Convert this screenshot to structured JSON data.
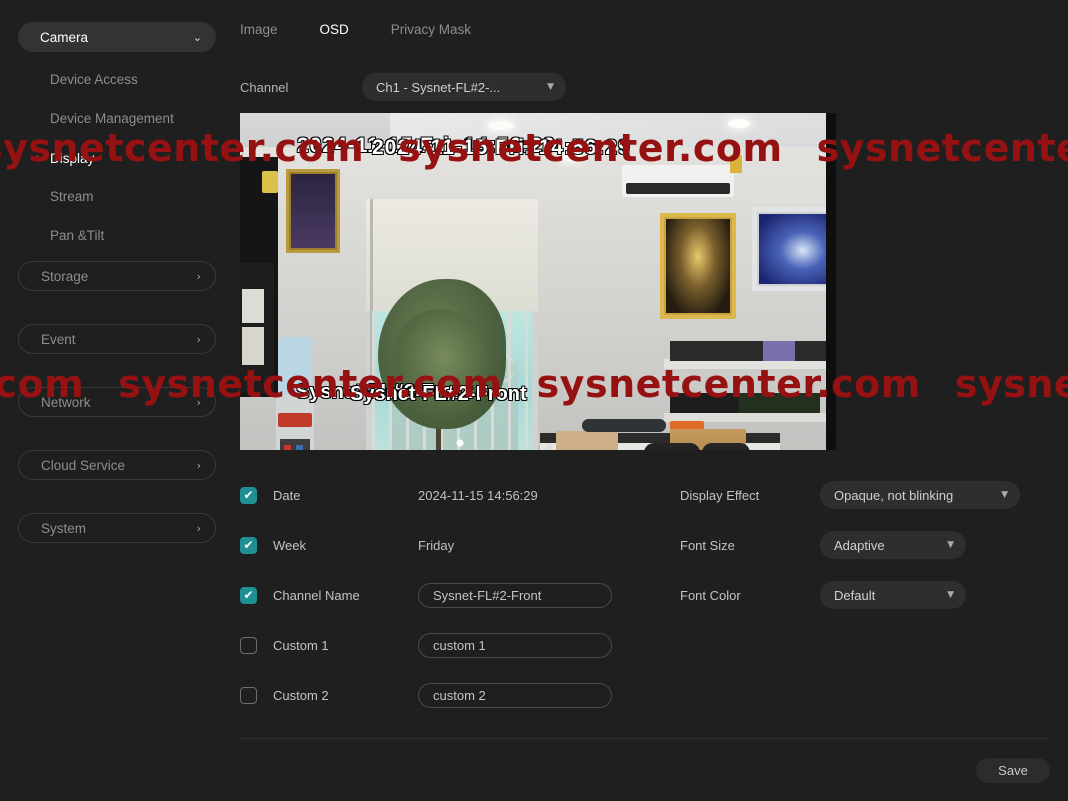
{
  "sidebar": {
    "groups": [
      {
        "label": "Camera",
        "icon": "chevron-down-icon",
        "state": "expanded"
      },
      {
        "label": "Storage",
        "icon": "chevron-right-icon",
        "state": "collapsed"
      },
      {
        "label": "Event",
        "icon": "chevron-right-icon",
        "state": "collapsed"
      },
      {
        "label": "Network",
        "icon": "chevron-right-icon",
        "state": "collapsed"
      },
      {
        "label": "Cloud Service",
        "icon": "chevron-right-icon",
        "state": "collapsed"
      },
      {
        "label": "System",
        "icon": "chevron-right-icon",
        "state": "collapsed"
      }
    ],
    "camera_items": [
      {
        "label": "Device Access",
        "active": false
      },
      {
        "label": "Device Management",
        "active": false
      },
      {
        "label": "Display",
        "active": true
      },
      {
        "label": "Stream",
        "active": false
      },
      {
        "label": "Pan &Tilt",
        "active": false
      }
    ],
    "chevron_down": "⌄",
    "chevron_right": "›"
  },
  "tabs": [
    {
      "label": "Image",
      "active": false
    },
    {
      "label": "OSD",
      "active": true
    },
    {
      "label": "Privacy Mask",
      "active": false
    }
  ],
  "channel": {
    "label": "Channel",
    "value": "Ch1 - Sysnet-FL#2-...",
    "caret": "▼"
  },
  "video_osd": {
    "datetime": "2024-11-15 Fri. 14:56:29",
    "channel_name": "Sysnet-FL#2-Front"
  },
  "osd_rows": [
    {
      "key": "date",
      "checked": true,
      "label": "Date",
      "value": "2024-11-15 14:56:29",
      "type": "text"
    },
    {
      "key": "week",
      "checked": true,
      "label": "Week",
      "value": "Friday",
      "type": "text"
    },
    {
      "key": "channel_name",
      "checked": true,
      "label": "Channel Name",
      "value": "Sysnet-FL#2-Front",
      "type": "input"
    },
    {
      "key": "custom1",
      "checked": false,
      "label": "Custom 1",
      "value": "custom 1",
      "type": "input"
    },
    {
      "key": "custom2",
      "checked": false,
      "label": "Custom 2",
      "value": "custom 2",
      "type": "input"
    }
  ],
  "settings": [
    {
      "key": "display_effect",
      "label": "Display Effect",
      "value": "Opaque, not blinking"
    },
    {
      "key": "font_size",
      "label": "Font Size",
      "value": "Adaptive"
    },
    {
      "key": "font_color",
      "label": "Font Color",
      "value": "Default"
    }
  ],
  "footer": {
    "save_label": "Save"
  },
  "watermark": {
    "text": "sysnetcenter.com",
    "color": "#961212"
  },
  "checkbox": {
    "tick": "✔"
  },
  "colors": {
    "background": "#1f1f1f",
    "accent_checkbox": "#1f8f93",
    "active_text": "#ffffff",
    "muted_text": "#8d8d8d"
  }
}
